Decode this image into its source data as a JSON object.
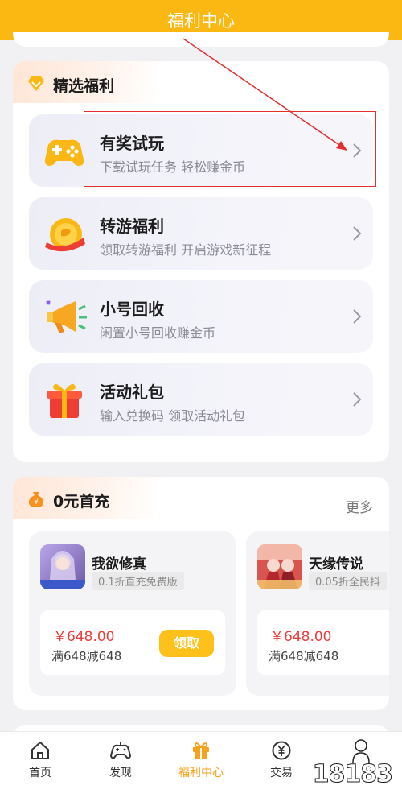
{
  "header": {
    "title": "福利中心"
  },
  "welfare": {
    "title": "精选福利",
    "items": [
      {
        "title": "有奖试玩",
        "subtitle": "下载试玩任务 轻松赚金币",
        "icon": "gamepad-icon"
      },
      {
        "title": "转游福利",
        "subtitle": "领取转游福利 开启游戏新征程",
        "icon": "gold-coin-icon"
      },
      {
        "title": "小号回收",
        "subtitle": "闲置小号回收赚金币",
        "icon": "megaphone-icon"
      },
      {
        "title": "活动礼包",
        "subtitle": "输入兑换码 领取活动礼包",
        "icon": "gift-box-icon"
      }
    ]
  },
  "zero_recharge": {
    "title": "0元首充",
    "more": "更多",
    "games": [
      {
        "name": "我欲修真",
        "tag": "0.1折直充免费版",
        "price": "￥648.00",
        "deal": "满648减648",
        "button": "领取"
      },
      {
        "name": "天缘传说",
        "tag": "0.05折全民抖",
        "price": "￥648.00",
        "deal": "满648减648"
      }
    ]
  },
  "tabs": [
    {
      "label": "首页",
      "icon": "home-icon"
    },
    {
      "label": "发现",
      "icon": "gamepad-outline-icon"
    },
    {
      "label": "福利中心",
      "icon": "gift-icon",
      "active": true
    },
    {
      "label": "交易",
      "icon": "yen-coin-icon"
    }
  ],
  "watermark": "18183",
  "colors": {
    "accent": "#fbb812",
    "price": "#ee3b3b",
    "active_tab": "#f6a21a",
    "annotation": "#e23030"
  }
}
